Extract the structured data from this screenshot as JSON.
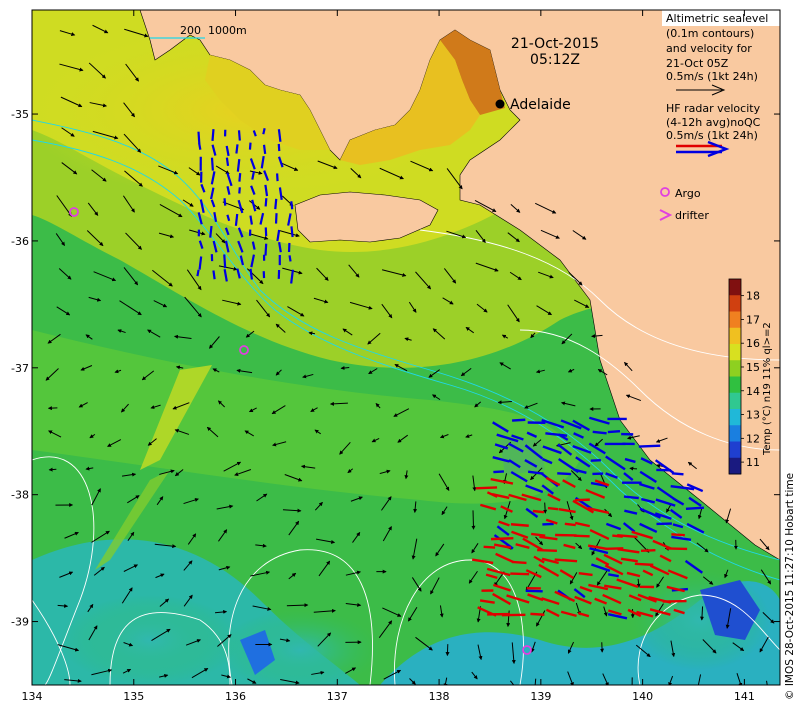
{
  "header": {
    "date": "21-Oct-2015",
    "time": "05:12Z"
  },
  "city": {
    "name": "Adelaide"
  },
  "scale_bar": {
    "label_short": "200",
    "label_long": "1000m"
  },
  "legend": {
    "altimetry_lines": [
      "Altimetric sealevel",
      "(0.1m contours)",
      "and velocity for",
      "21-Oct 05Z",
      "0.5m/s (1kt 24h)"
    ],
    "radar_lines": [
      "HF radar velocity",
      "(4-12h avg)noQC",
      "0.5m/s (1kt 24h)"
    ],
    "argo_label": "Argo",
    "drifter_label": "drifter",
    "argo_color": "#e040e0",
    "radar_colors": [
      "#e00000",
      "#0000e0"
    ]
  },
  "colorbar": {
    "label": "Temp (°C) n19 11% ql>=2",
    "ticks": [
      "11",
      "12",
      "13",
      "14",
      "15",
      "16",
      "17",
      "18"
    ],
    "min": 10.5,
    "max": 18.7,
    "colors": [
      "#1a1a80",
      "#1f3fd0",
      "#1a7fe0",
      "#20b8d8",
      "#30c890",
      "#30c040",
      "#8ed020",
      "#d8e020",
      "#f0c020",
      "#f08020",
      "#d04010",
      "#801010"
    ]
  },
  "axes": {
    "x_ticks": [
      "134",
      "135",
      "136",
      "137",
      "138",
      "139",
      "140",
      "141"
    ],
    "y_ticks": [
      "-35",
      "-36",
      "-37",
      "-38",
      "-39"
    ],
    "x_range": [
      134,
      141.35
    ],
    "y_range": [
      -39.5,
      -34.18
    ]
  },
  "credit": "© IMOS 28-Oct-2015 11:27:10 Hobart time",
  "colors": {
    "land": "#f9c9a0",
    "ocean_warm": "#d8e020",
    "ocean_mid": "#30c040",
    "ocean_cool": "#20b8d8"
  }
}
